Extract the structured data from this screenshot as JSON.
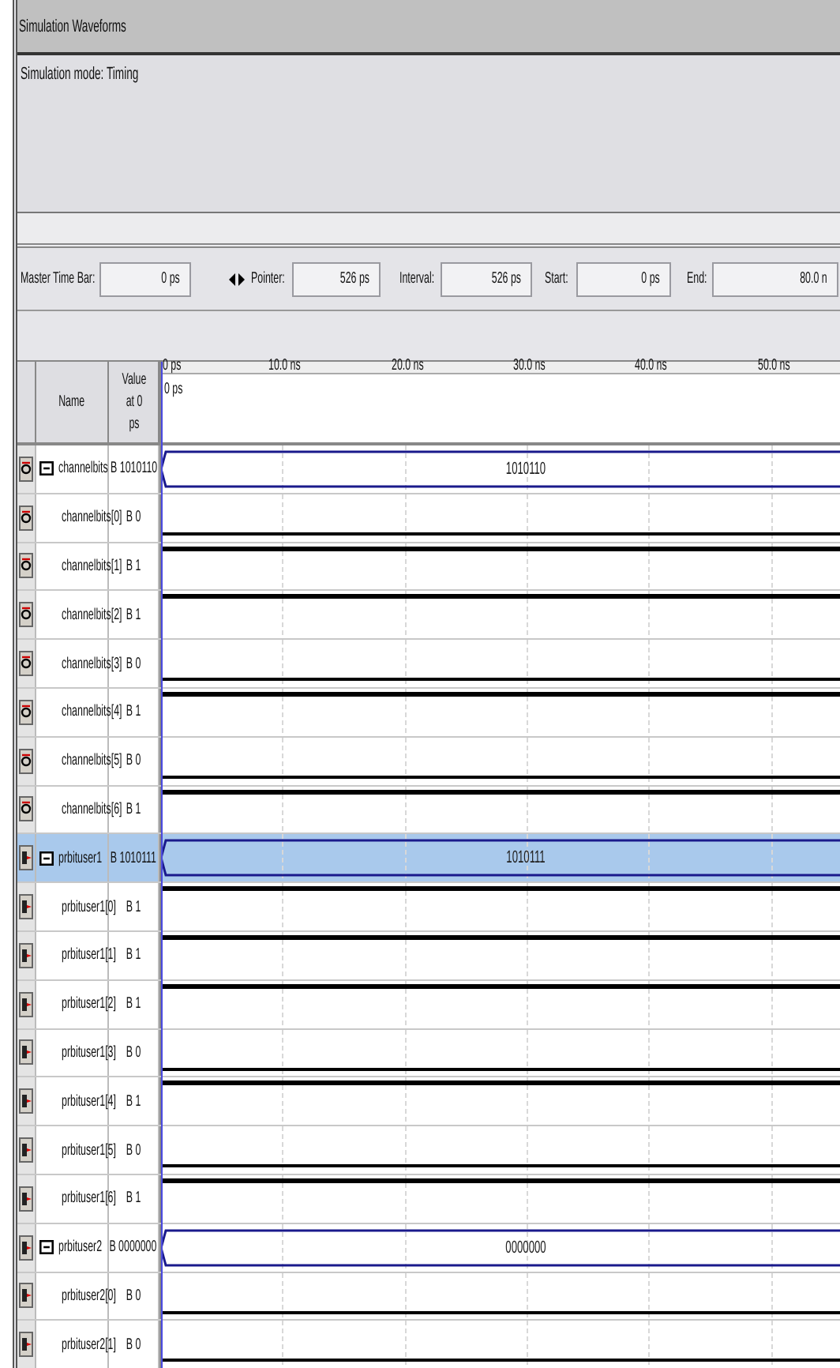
{
  "title": "Simulation Waveforms",
  "info": "Simulation mode: Timing",
  "time_bar": [
    {
      "label": "Master Time Bar:",
      "value": "0 ps"
    },
    {
      "label": "Pointer:",
      "value": "526 ps"
    },
    {
      "label": "Interval:",
      "value": "526 ps"
    },
    {
      "label": "Start:",
      "value": "0 ps"
    },
    {
      "label": "End:",
      "value": "80.0 n"
    }
  ],
  "columns": {
    "name": "Name",
    "value": "Value at 0 ps"
  },
  "ruler": [
    "0 ps",
    "10.0 ns",
    "20.0 ns",
    "30.0 ns",
    "40.0 ns",
    "50.0 ns"
  ],
  "cursor_label": "0 ps",
  "signals": [
    {
      "name": "channelbits",
      "kind": "input",
      "value": "B 1010110",
      "wave": "1010110",
      "selected": false,
      "expanded": true,
      "children": [
        {
          "name": "channelbits[0]",
          "kind": "input",
          "value": "B 0",
          "high": false,
          "selected": false
        },
        {
          "name": "channelbits[1]",
          "kind": "input",
          "value": "B 1",
          "high": true,
          "selected": false
        },
        {
          "name": "channelbits[2]",
          "kind": "input",
          "value": "B 1",
          "high": true,
          "selected": false
        },
        {
          "name": "channelbits[3]",
          "kind": "input",
          "value": "B 0",
          "high": false,
          "selected": false
        },
        {
          "name": "channelbits[4]",
          "kind": "input",
          "value": "B 1",
          "high": true,
          "selected": false
        },
        {
          "name": "channelbits[5]",
          "kind": "input",
          "value": "B 0",
          "high": false,
          "selected": false
        },
        {
          "name": "channelbits[6]",
          "kind": "input",
          "value": "B 1",
          "high": true,
          "selected": false
        }
      ]
    },
    {
      "name": "prbituser1",
      "kind": "output",
      "value": "B 1010111",
      "wave": "1010111",
      "selected": true,
      "expanded": true,
      "children": [
        {
          "name": "prbituser1[0]",
          "kind": "output",
          "value": "B 1",
          "high": true,
          "selected": false
        },
        {
          "name": "prbituser1[1]",
          "kind": "output",
          "value": "B 1",
          "high": true,
          "selected": false
        },
        {
          "name": "prbituser1[2]",
          "kind": "output",
          "value": "B 1",
          "high": true,
          "selected": false
        },
        {
          "name": "prbituser1[3]",
          "kind": "output",
          "value": "B 0",
          "high": false,
          "selected": false
        },
        {
          "name": "prbituser1[4]",
          "kind": "output",
          "value": "B 1",
          "high": true,
          "selected": false
        },
        {
          "name": "prbituser1[5]",
          "kind": "output",
          "value": "B 0",
          "high": false,
          "selected": false
        },
        {
          "name": "prbituser1[6]",
          "kind": "output",
          "value": "B 1",
          "high": true,
          "selected": false
        }
      ]
    },
    {
      "name": "prbituser2",
      "kind": "output",
      "value": "B 0000000",
      "wave": "0000000",
      "selected": false,
      "expanded": true,
      "children": [
        {
          "name": "prbituser2[0]",
          "kind": "output",
          "value": "B 0",
          "high": false,
          "selected": false
        },
        {
          "name": "prbituser2[1]",
          "kind": "output",
          "value": "B 0",
          "high": false,
          "selected": false
        }
      ]
    }
  ]
}
